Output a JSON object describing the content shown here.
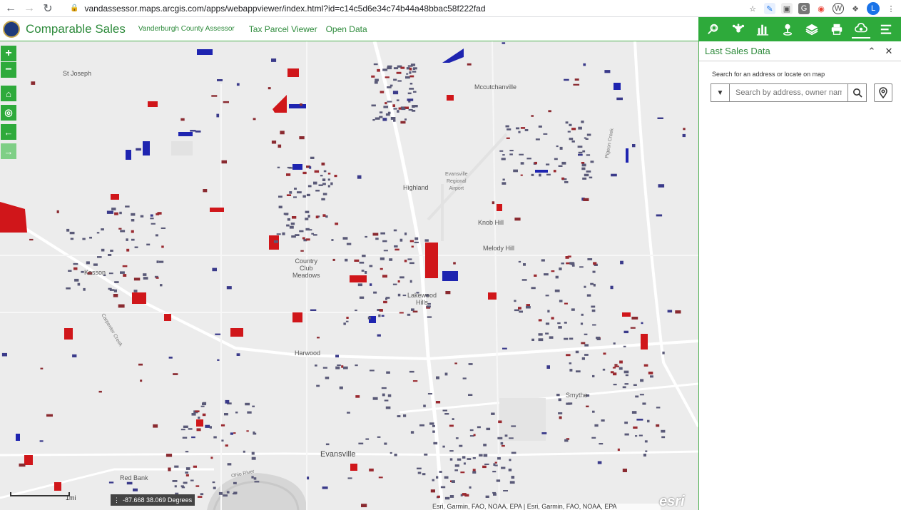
{
  "browser": {
    "url": "vandassessor.maps.arcgis.com/apps/webappviewer/index.html?id=c14c5d6e34c74b44a48bbac58f222fad",
    "profile_initial": "L"
  },
  "header": {
    "title": "Comparable Sales",
    "links": [
      "Vanderburgh County Assessor",
      "Tax Parcel Viewer",
      "Open Data"
    ]
  },
  "toolbar": {
    "tools": [
      "search-parcel-icon",
      "network-icon",
      "bar-chart-icon",
      "location-pin-icon",
      "layers-icon",
      "print-icon",
      "cloud-icon",
      "menu-icon"
    ]
  },
  "panel": {
    "title": "Last Sales Data",
    "hint": "Search for an address or locate on map",
    "search_placeholder": "Search by address, owner name, or parcel"
  },
  "map": {
    "labels": {
      "st_joseph": "St Joseph",
      "mccutchanville": "Mccutchanville",
      "highland": "Highland",
      "evansville_airport": "Evansville\nRegional\nAirport",
      "knob_hill": "Knob Hill",
      "melody_hill": "Melody Hill",
      "kasson": "Kasson",
      "country_club": "Country\nClub\nMeadows",
      "lakewood_hills": "Lakewood\nHills",
      "harwood": "Harwood",
      "smythe": "Smythe",
      "evansville": "Evansville",
      "red_bank": "Red Bank",
      "ohio_river": "Ohio River",
      "carpenter_creek": "Carpenter Creek",
      "pigeon_creek": "Pigeon Creek"
    },
    "coordinates": "-87.668 38.069 Degrees",
    "scale": "1mi",
    "attribution": "Esri, Garmin, FAO, NOAA, EPA | Esri, Garmin, FAO, NOAA, EPA",
    "brand": "esri"
  }
}
